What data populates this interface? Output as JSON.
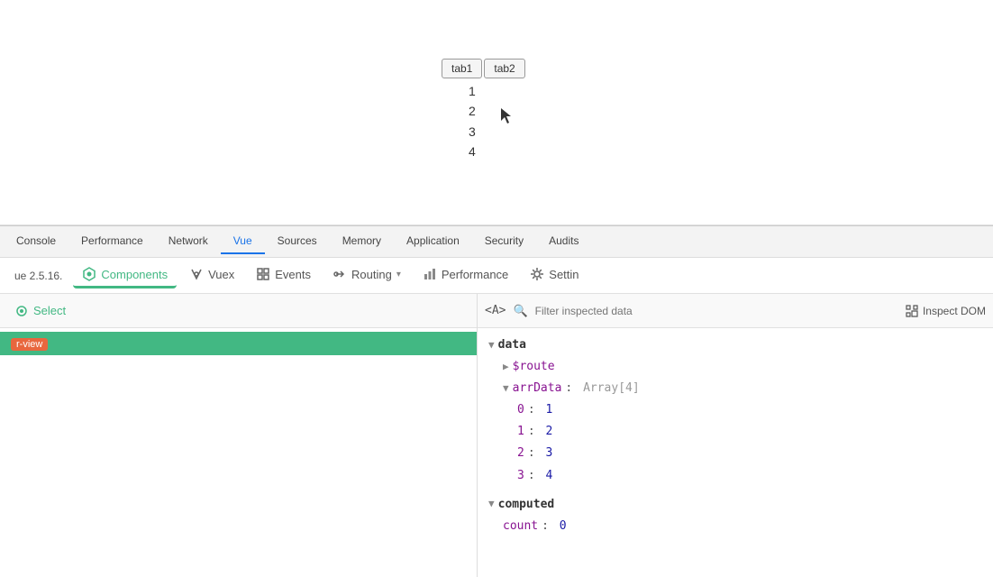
{
  "browser": {
    "tabs": [
      {
        "label": "tab1"
      },
      {
        "label": "tab2"
      }
    ],
    "content_numbers": [
      "1",
      "2",
      "3",
      "4"
    ]
  },
  "devtools": {
    "tabs": [
      {
        "label": "Console",
        "id": "console"
      },
      {
        "label": "Performance",
        "id": "performance"
      },
      {
        "label": "Network",
        "id": "network"
      },
      {
        "label": "Vue",
        "id": "vue",
        "active": true
      },
      {
        "label": "Sources",
        "id": "sources"
      },
      {
        "label": "Memory",
        "id": "memory"
      },
      {
        "label": "Application",
        "id": "application"
      },
      {
        "label": "Security",
        "id": "security"
      },
      {
        "label": "Audits",
        "id": "audits"
      }
    ]
  },
  "vue_toolbar": {
    "version_text": "ue 2.5.16.",
    "tools": [
      {
        "id": "components",
        "label": "Components",
        "active": true
      },
      {
        "id": "vuex",
        "label": "Vuex"
      },
      {
        "id": "events",
        "label": "Events"
      },
      {
        "id": "routing",
        "label": "Routing"
      },
      {
        "id": "performance",
        "label": "Performance"
      },
      {
        "id": "settings",
        "label": "Settin"
      }
    ]
  },
  "inspector": {
    "select_label": "Select",
    "filter_placeholder": "Filter inspected data",
    "inspect_dom_label": "Inspect DOM",
    "component_label": "r-view",
    "data_section": {
      "label": "data",
      "route_key": "$route",
      "arr_data": {
        "key": "arrData",
        "type": "Array[4]",
        "items": [
          {
            "index": "0",
            "value": "1"
          },
          {
            "index": "1",
            "value": "2"
          },
          {
            "index": "2",
            "value": "3"
          },
          {
            "index": "3",
            "value": "4"
          }
        ]
      }
    },
    "computed_section": {
      "label": "computed",
      "count_key": "count",
      "count_value": "0"
    }
  },
  "icons": {
    "components": "⬡",
    "vuex": "◈",
    "events": "⊞",
    "routing": "◇",
    "performance": "▦",
    "settings": "⚙",
    "select": "⊙",
    "search": "🔍",
    "angle_bracket": "<>",
    "triangle_right": "▶",
    "triangle_down": "▼",
    "chevron_down": "▾"
  },
  "colors": {
    "vue_green": "#42b883",
    "accent_blue": "#1a73e8",
    "orange": "#e8673e",
    "key_purple": "#881391",
    "value_blue": "#1a1aa6"
  }
}
